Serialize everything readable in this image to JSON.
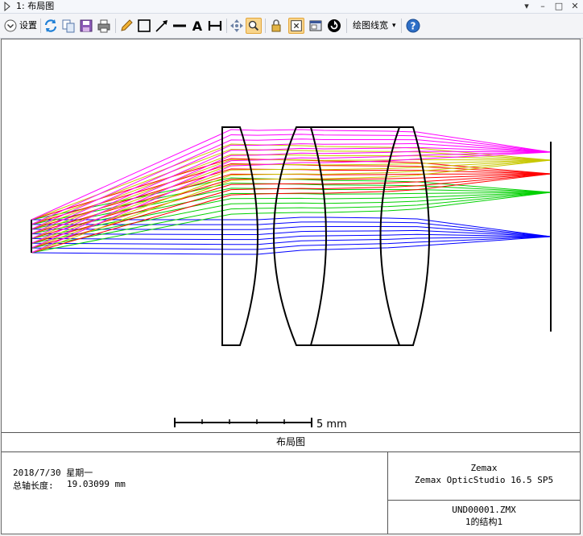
{
  "window": {
    "title": "1: 布局图"
  },
  "toolbar": {
    "settings_label": "设置",
    "linewidth_label": "绘图线宽",
    "buttons": [
      "refresh-icon",
      "copy-icon",
      "save-icon",
      "print-icon",
      "pencil-icon",
      "rectangle-icon",
      "arrow-icon",
      "line-icon",
      "text-icon",
      "dimension-icon",
      "pan-icon",
      "zoom-icon",
      "lock-icon",
      "fit-icon",
      "window-icon",
      "rotate-icon",
      "help-icon"
    ],
    "active_button": "zoom-icon"
  },
  "plot": {
    "scale_label": "5 mm",
    "ray_colors": {
      "field1": "#0000ff",
      "field2": "#00d000",
      "field3": "#ff0000",
      "field4": "#c8c800",
      "field5": "#ff00ff"
    }
  },
  "footer": {
    "title": "布局图",
    "date": "2018/7/30 星期一",
    "axial_length_label": "总轴长度:",
    "axial_length_value": "19.03099 mm",
    "company": "Zemax",
    "product": "Zemax OpticStudio 16.5 SP5",
    "file": "UND00001.ZMX",
    "config": "1的结构1"
  }
}
